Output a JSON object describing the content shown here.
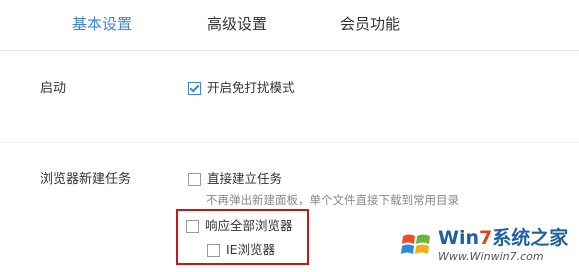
{
  "tabs": [
    {
      "label": "基本设置",
      "active": true
    },
    {
      "label": "高级设置",
      "active": false
    },
    {
      "label": "会员功能",
      "active": false
    }
  ],
  "sections": {
    "startup": {
      "label": "启动",
      "options": [
        {
          "label": "开启免打扰模式",
          "checked": true
        }
      ]
    },
    "browser_task": {
      "label": "浏览器新建任务",
      "direct_create": {
        "label": "直接建立任务",
        "checked": false
      },
      "direct_create_desc": "不再弹出新建面板，单个文件直接下载到常用目录",
      "respond_all": {
        "label": "响应全部浏览器",
        "checked": false
      },
      "ie_browser": {
        "label": "IE浏览器",
        "checked": false
      }
    }
  },
  "colors": {
    "accent": "#3c86d6",
    "highlight_border": "#c8161d",
    "muted_text": "#888888"
  },
  "watermark": {
    "title_part1": "Win",
    "title_part2": "7",
    "title_part3": "系统之家",
    "url": "Www.Winwin7.com"
  }
}
